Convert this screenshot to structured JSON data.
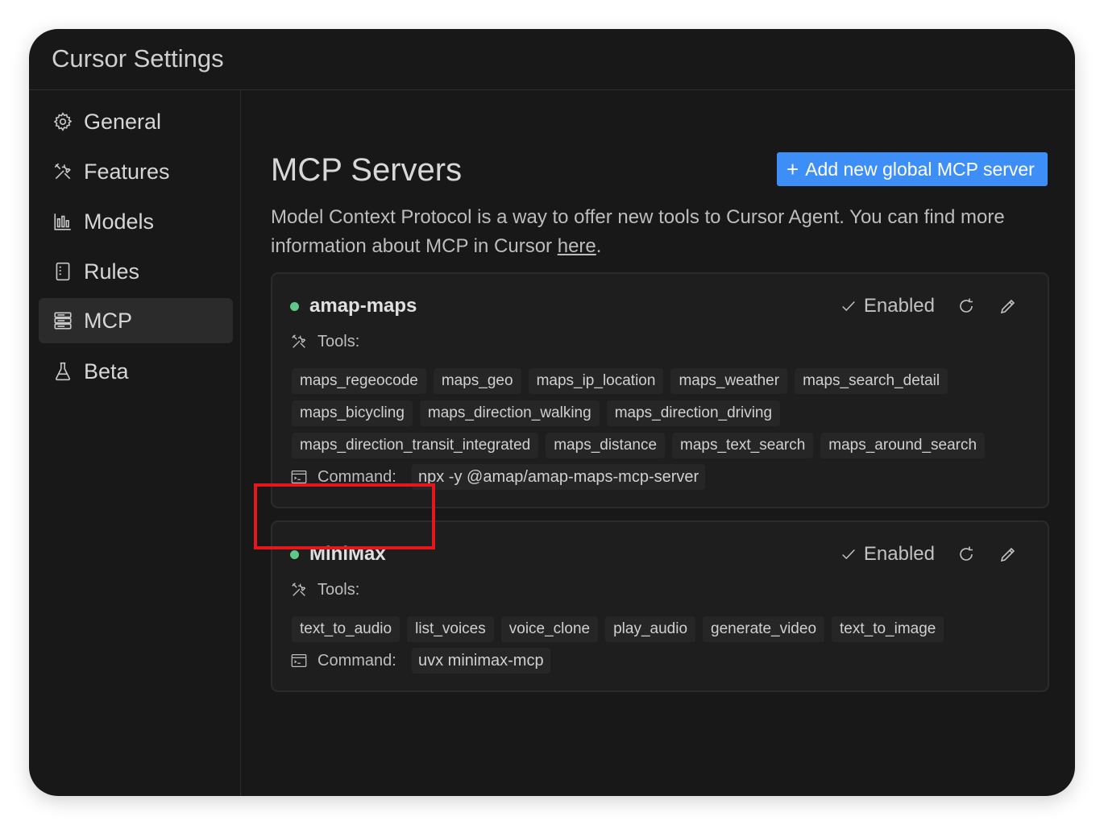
{
  "window": {
    "title": "Cursor Settings"
  },
  "sidebar": {
    "items": [
      {
        "label": "General",
        "icon": "gear-icon",
        "active": false
      },
      {
        "label": "Features",
        "icon": "tools-icon",
        "active": false
      },
      {
        "label": "Models",
        "icon": "chart-icon",
        "active": false
      },
      {
        "label": "Rules",
        "icon": "document-icon",
        "active": false
      },
      {
        "label": "MCP",
        "icon": "server-icon",
        "active": true
      },
      {
        "label": "Beta",
        "icon": "flask-icon",
        "active": false
      }
    ]
  },
  "main": {
    "title": "MCP Servers",
    "add_button": {
      "plus": "+",
      "label": "Add new global MCP server"
    },
    "description": "Model Context Protocol is a way to offer new tools to Cursor Agent. You can find more information about MCP in Cursor ",
    "description_link": "here",
    "description_end": ".",
    "servers": [
      {
        "name": "amap-maps",
        "status_color": "#5fc98a",
        "enabled_label": "Enabled",
        "tools_label": "Tools:",
        "tool_rows": [
          [
            "maps_regeocode",
            "maps_geo",
            "maps_ip_location",
            "maps_weather",
            "maps_search_detail"
          ],
          [
            "maps_bicycling",
            "maps_direction_walking",
            "maps_direction_driving"
          ],
          [
            "maps_direction_transit_integrated",
            "maps_distance",
            "maps_text_search",
            "maps_around_search"
          ]
        ],
        "command_label": "Command:",
        "command": "npx -y @amap/amap-maps-mcp-server"
      },
      {
        "name": "MiniMax",
        "status_color": "#5fc98a",
        "enabled_label": "Enabled",
        "tools_label": "Tools:",
        "tool_rows": [
          [
            "text_to_audio",
            "list_voices",
            "voice_clone",
            "play_audio",
            "generate_video",
            "text_to_image"
          ]
        ],
        "command_label": "Command:",
        "command": "uvx minimax-mcp"
      }
    ]
  },
  "colors": {
    "accent": "#3e8ef7",
    "status_ok": "#5fc98a",
    "highlight": "#e8151b"
  }
}
